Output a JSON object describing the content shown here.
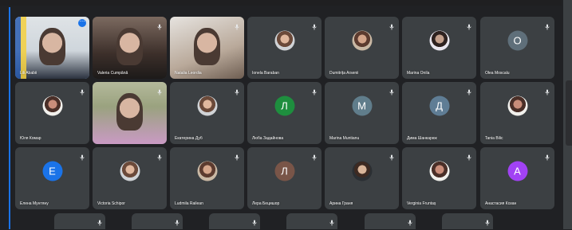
{
  "participants": [
    {
      "name": "Lili Ababii",
      "kind": "video",
      "speaking": true,
      "more": true
    },
    {
      "name": "Valeria Cumpănă",
      "kind": "video"
    },
    {
      "name": "Natalia Leordia",
      "kind": "video"
    },
    {
      "name": "Ionela Baraban",
      "kind": "photo"
    },
    {
      "name": "Dumitrița Arsenii",
      "kind": "photo"
    },
    {
      "name": "Marina Onila",
      "kind": "photo"
    },
    {
      "name": "Olea Moscalu",
      "kind": "letter",
      "letter": "O",
      "color": "#5f6f7a"
    },
    {
      "name": "Юля Комар",
      "kind": "photo"
    },
    {
      "name": "",
      "kind": "video"
    },
    {
      "name": "Екатерина Дуб",
      "kind": "photo"
    },
    {
      "name": "Люба Задайнова",
      "kind": "letter",
      "letter": "Л",
      "color": "#1e8e3e"
    },
    {
      "name": "Marina Muntianu",
      "kind": "letter",
      "letter": "M",
      "color": "#607d8b"
    },
    {
      "name": "Дима Шанкарюк",
      "kind": "letter",
      "letter": "Д",
      "color": "#5f7d95"
    },
    {
      "name": "Tania Bilic",
      "kind": "photo"
    },
    {
      "name": "Елена Мунтяну",
      "kind": "letter",
      "letter": "E",
      "color": "#1a73e8"
    },
    {
      "name": "Victoria Schipor",
      "kind": "photo"
    },
    {
      "name": "Ludmila Railean",
      "kind": "photo"
    },
    {
      "name": "Лера Бецишор",
      "kind": "letter",
      "letter": "Л",
      "color": "#795548"
    },
    {
      "name": "Арина Граня",
      "kind": "photo"
    },
    {
      "name": "Verginia Fruntaș",
      "kind": "photo"
    },
    {
      "name": "Анастасия Козан",
      "kind": "letter",
      "letter": "A",
      "color": "#a142f4"
    }
  ],
  "bottom_row_count": 6,
  "colors": {
    "accent": "#1a73e8",
    "tile": "#3c4043",
    "background": "#202124",
    "speaking": "#8ab4f8"
  }
}
